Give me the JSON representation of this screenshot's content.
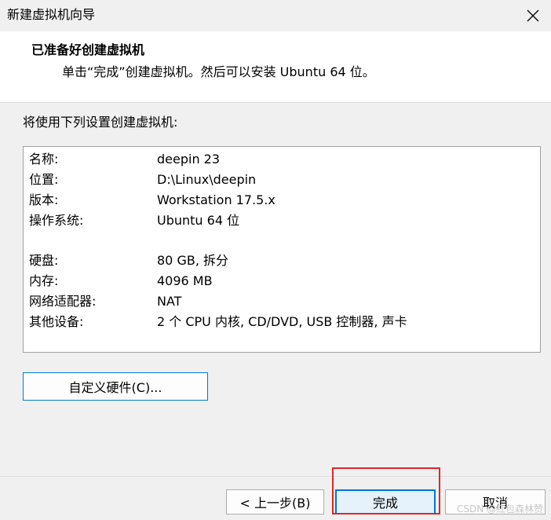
{
  "window": {
    "title": "新建虚拟机向导"
  },
  "header": {
    "title": "已准备好创建虚拟机",
    "subtitle": "单击“完成”创建虚拟机。然后可以安装 Ubuntu 64 位。"
  },
  "intro": "将使用下列设置创建虚拟机:",
  "summary": [
    {
      "label": "名称:",
      "value": "deepin 23"
    },
    {
      "label": "位置:",
      "value": "D:\\Linux\\deepin"
    },
    {
      "label": "版本:",
      "value": "Workstation 17.5.x"
    },
    {
      "label": "操作系统:",
      "value": "Ubuntu 64 位"
    },
    {
      "label": "硬盘:",
      "value": "80 GB, 拆分"
    },
    {
      "label": "内存:",
      "value": "4096 MB"
    },
    {
      "label": "网络适配器:",
      "value": "NAT"
    },
    {
      "label": "其他设备:",
      "value": "2 个 CPU 内核, CD/DVD, USB 控制器, 声卡"
    }
  ],
  "buttons": {
    "customize": "自定义硬件(C)...",
    "back": "< 上一步(B)",
    "finish": "完成",
    "cancel": "取消"
  },
  "watermark": "CSDN @红包森林赞",
  "colors": {
    "accent": "#0078d7",
    "highlight": "#e0262b"
  }
}
